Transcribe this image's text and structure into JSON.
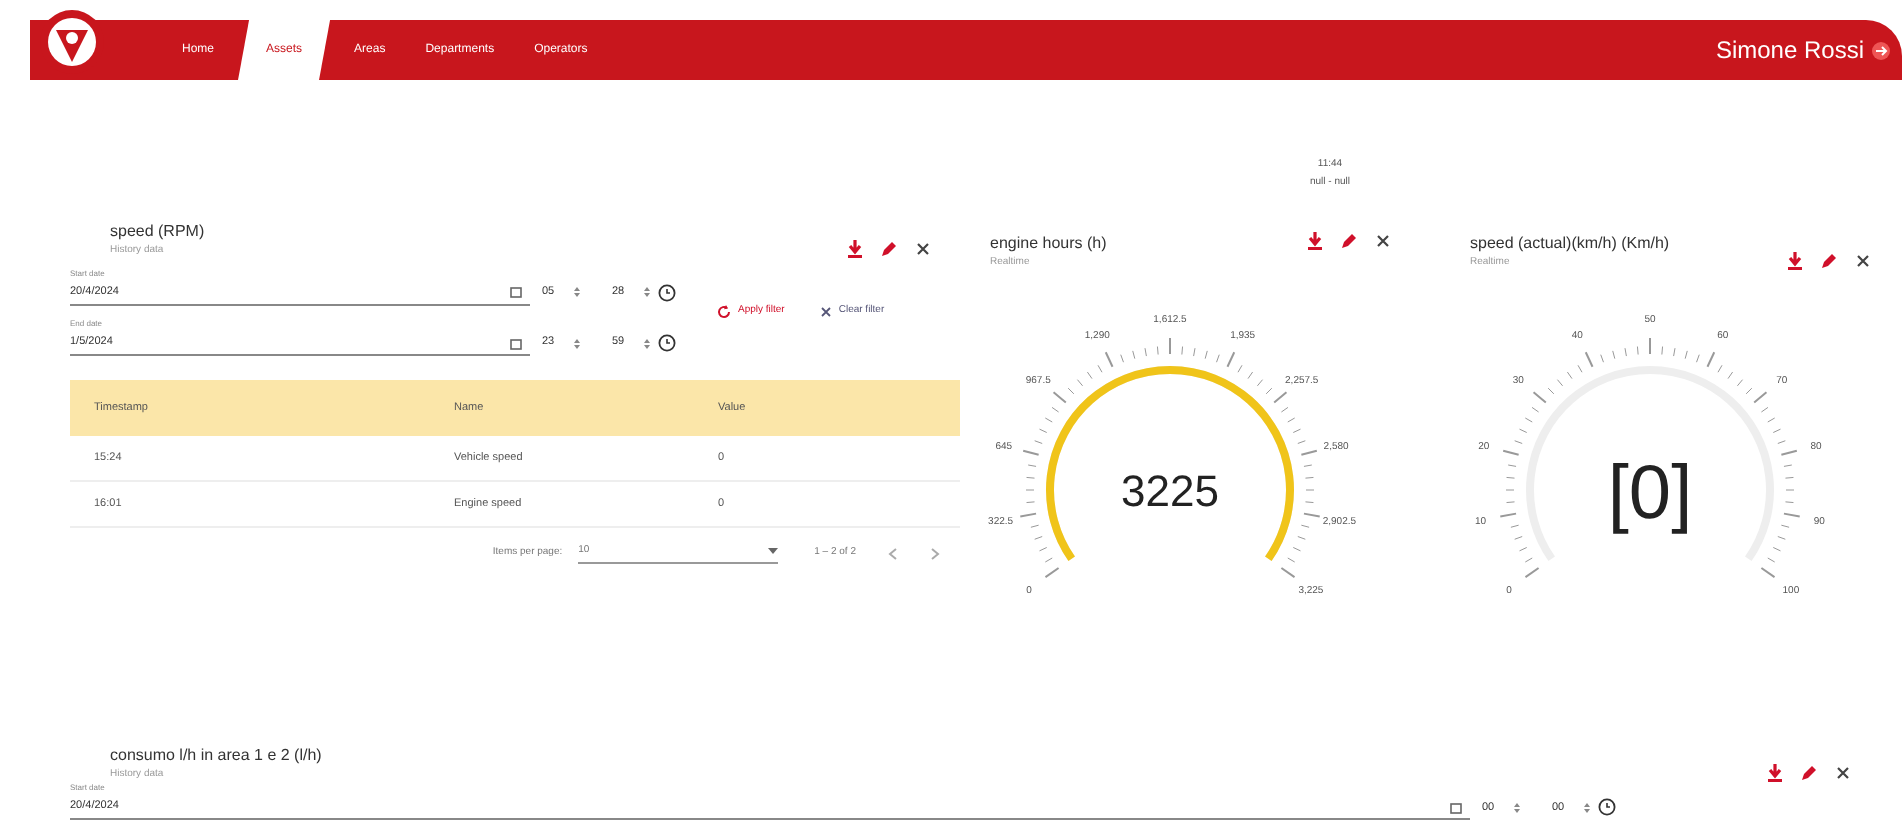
{
  "nav": {
    "tabs": [
      {
        "label": "Home",
        "selected": false
      },
      {
        "label": "Assets",
        "selected": true
      },
      {
        "label": "Areas",
        "selected": false
      },
      {
        "label": "Departments",
        "selected": false
      },
      {
        "label": "Operators",
        "selected": false
      }
    ],
    "user": "Simone Rossi"
  },
  "top_note": {
    "time": "11:44",
    "range": "null - null"
  },
  "history_widget": {
    "title": "speed (RPM)",
    "subtitle": "History data",
    "start": {
      "label": "Start date",
      "date": "20/4/2024",
      "hour": "05",
      "minute": "28"
    },
    "end": {
      "label": "End date",
      "date": "1/5/2024",
      "hour": "23",
      "minute": "59"
    },
    "apply": "Apply filter",
    "clear": "Clear filter",
    "columns": [
      "Timestamp",
      "Name",
      "Value"
    ],
    "rows": [
      [
        "15:24",
        "Vehicle speed",
        "0"
      ],
      [
        "16:01",
        "Engine speed",
        "0"
      ]
    ],
    "paginator": {
      "label": "Items per page:",
      "size": "10",
      "range": "1 – 2 of 2"
    }
  },
  "gauges": [
    {
      "title": "engine hours (h)",
      "subtitle": "Realtime",
      "value": "3225",
      "level": 1,
      "ticks": [
        "0",
        "322.5",
        "645",
        "967.5",
        "1,290",
        "1,612.5",
        "1,935",
        "2,257.5",
        "2,580",
        "2,902.5",
        "3,225"
      ]
    },
    {
      "title": "speed (actual)(km/h) (Km/h)",
      "subtitle": "Realtime",
      "value": "[0]",
      "ticks": [
        "0",
        "10",
        "20",
        "30",
        "40",
        "50",
        "60",
        "70",
        "80",
        "90",
        "100"
      ]
    }
  ],
  "bottom_widget": {
    "title": "consumo l/h in area 1 e 2 (l/h)",
    "subtitle": "History data",
    "start": {
      "label": "Start date",
      "date": "20/4/2024",
      "hour": "00",
      "minute": "00"
    }
  }
}
